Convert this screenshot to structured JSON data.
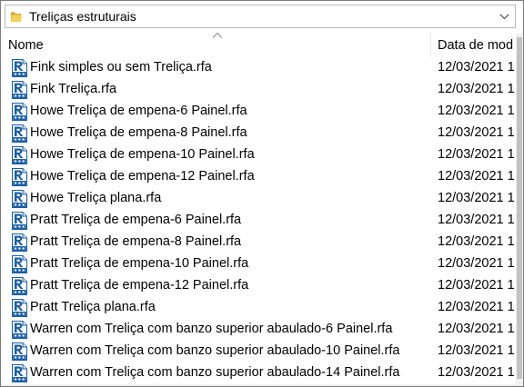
{
  "location": {
    "folder_icon": "folder-icon",
    "path": "Treliças estruturais",
    "dropdown_icon": "chevron-down-icon"
  },
  "columns": {
    "name": "Nome",
    "date": "Data de mod",
    "sort_icon": "sort-ascending-icon"
  },
  "files": [
    {
      "name": "Fink simples ou sem Treliça.rfa",
      "date": "12/03/2021 1",
      "icon": "revit-family-file-icon"
    },
    {
      "name": "Fink Treliça.rfa",
      "date": "12/03/2021 1",
      "icon": "revit-family-file-icon"
    },
    {
      "name": "Howe Treliça de empena-6 Painel.rfa",
      "date": "12/03/2021 1",
      "icon": "revit-family-file-icon"
    },
    {
      "name": "Howe Treliça de empena-8 Painel.rfa",
      "date": "12/03/2021 1",
      "icon": "revit-family-file-icon"
    },
    {
      "name": "Howe Treliça de empena-10 Painel.rfa",
      "date": "12/03/2021 1",
      "icon": "revit-family-file-icon"
    },
    {
      "name": "Howe Treliça de empena-12 Painel.rfa",
      "date": "12/03/2021 1",
      "icon": "revit-family-file-icon"
    },
    {
      "name": "Howe Treliça plana.rfa",
      "date": "12/03/2021 1",
      "icon": "revit-family-file-icon"
    },
    {
      "name": "Pratt Treliça de empena-6 Painel.rfa",
      "date": "12/03/2021 1",
      "icon": "revit-family-file-icon"
    },
    {
      "name": "Pratt Treliça de empena-8 Painel.rfa",
      "date": "12/03/2021 1",
      "icon": "revit-family-file-icon"
    },
    {
      "name": "Pratt Treliça de empena-10 Painel.rfa",
      "date": "12/03/2021 1",
      "icon": "revit-family-file-icon"
    },
    {
      "name": "Pratt Treliça de empena-12 Painel.rfa",
      "date": "12/03/2021 1",
      "icon": "revit-family-file-icon"
    },
    {
      "name": "Pratt Treliça plana.rfa",
      "date": "12/03/2021 1",
      "icon": "revit-family-file-icon"
    },
    {
      "name": "Warren com Treliça com banzo superior abaulado-6 Painel.rfa",
      "date": "12/03/2021 1",
      "icon": "revit-family-file-icon"
    },
    {
      "name": "Warren com Treliça com banzo superior abaulado-10 Painel.rfa",
      "date": "12/03/2021 1",
      "icon": "revit-family-file-icon"
    },
    {
      "name": "Warren com Treliça com banzo superior abaulado-14 Painel.rfa",
      "date": "12/03/2021 1",
      "icon": "revit-family-file-icon"
    }
  ],
  "colors": {
    "icon_blue": "#1a5ea8",
    "icon_band": "#6a8fc0",
    "folder_yellow": "#f3c84a"
  }
}
